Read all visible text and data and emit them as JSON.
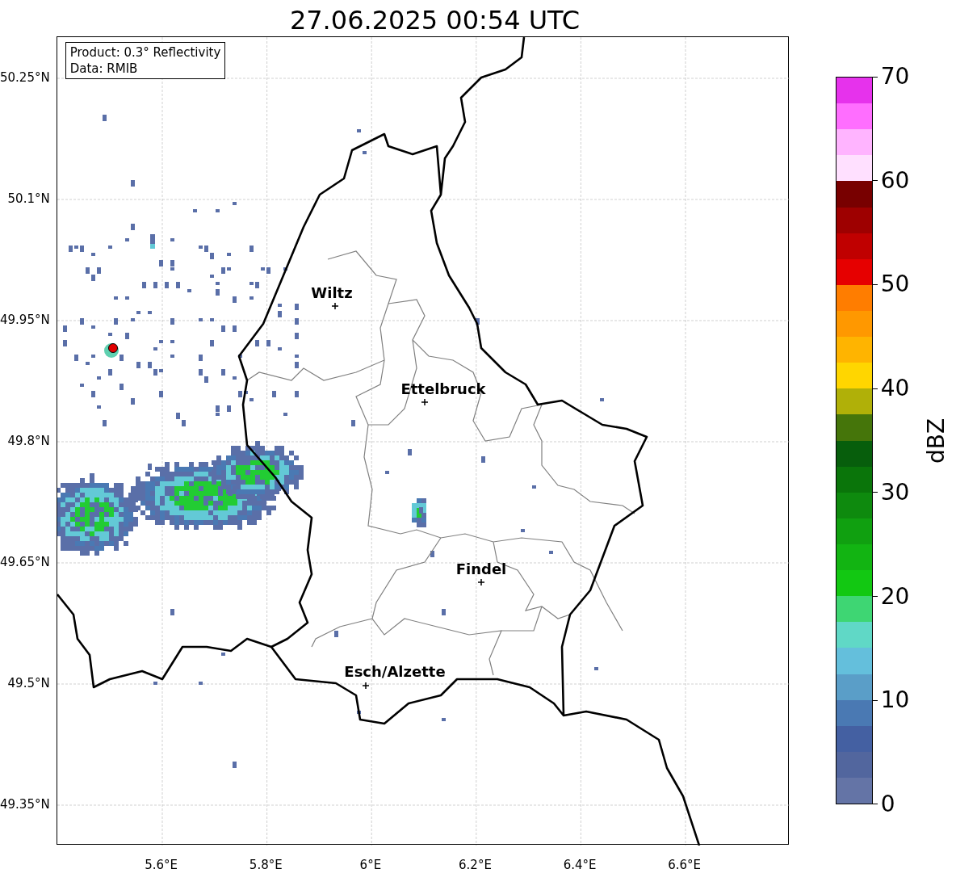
{
  "title": "27.06.2025 00:54 UTC",
  "legend": [
    "Product: 0.3° Reflectivity",
    "Data: RMIB"
  ],
  "y_ticks": [
    "50.25°N",
    "50.1°N",
    "49.95°N",
    "49.8°N",
    "49.65°N",
    "49.5°N",
    "49.35°N"
  ],
  "x_ticks": [
    "5.6°E",
    "5.8°E",
    "6°E",
    "6.2°E",
    "6.4°E",
    "6.6°E"
  ],
  "cities": [
    {
      "name": "Wiltz"
    },
    {
      "name": "Ettelbruck"
    },
    {
      "name": "Findel"
    },
    {
      "name": "Esch/Alzette"
    }
  ],
  "colorbar": {
    "label": "dBZ",
    "ticks": [
      "70",
      "60",
      "50",
      "40",
      "30",
      "20",
      "10",
      "0"
    ],
    "bands": [
      {
        "color": "#e632ec"
      },
      {
        "color": "#ff6eff"
      },
      {
        "color": "#ffb4ff"
      },
      {
        "color": "#ffe0ff"
      },
      {
        "color": "#780000"
      },
      {
        "color": "#9e0000"
      },
      {
        "color": "#c00000"
      },
      {
        "color": "#e60000"
      },
      {
        "color": "#ff7d00"
      },
      {
        "color": "#ff9800"
      },
      {
        "color": "#ffb400"
      },
      {
        "color": "#ffd600"
      },
      {
        "color": "#b0b008"
      },
      {
        "color": "#45750a"
      },
      {
        "color": "#075e0c"
      },
      {
        "color": "#0a750a"
      },
      {
        "color": "#0e8a0e"
      },
      {
        "color": "#10a010"
      },
      {
        "color": "#12b412"
      },
      {
        "color": "#12c812"
      },
      {
        "color": "#3ed673"
      },
      {
        "color": "#60d8c6"
      },
      {
        "color": "#64bfdc"
      },
      {
        "color": "#5a9ec8"
      },
      {
        "color": "#4a79b3"
      },
      {
        "color": "#4460a2"
      },
      {
        "color": "#52669e"
      },
      {
        "color": "#6474a6"
      }
    ]
  }
}
